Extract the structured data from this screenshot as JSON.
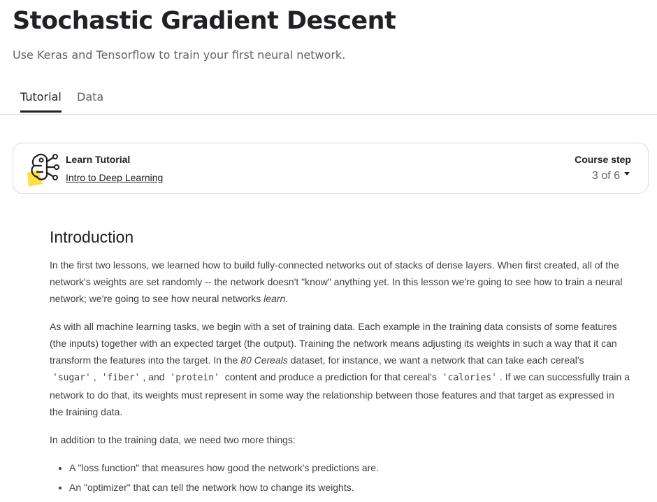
{
  "header": {
    "title": "Stochastic Gradient Descent",
    "subtitle": "Use Keras and Tensorflow to train your first neural network."
  },
  "tabs": [
    {
      "label": "Tutorial",
      "active": true
    },
    {
      "label": "Data",
      "active": false
    }
  ],
  "course_card": {
    "icon": "neural-network-icon",
    "kicker": "Learn Tutorial",
    "course_link": "Intro to Deep Learning",
    "step_label": "Course step",
    "step_value": "3 of 6"
  },
  "article": {
    "heading": "Introduction",
    "p1": {
      "text_a": "In the first two lessons, we learned how to build fully-connected networks out of stacks of dense layers. When first created, all of the network's weights are set randomly -- the network doesn't \"know\" anything yet. In this lesson we're going to see how to train a neural network; we're going to see how neural networks ",
      "emphasis": "learn",
      "text_b": "."
    },
    "p2": {
      "text_a": "As with all machine learning tasks, we begin with a set of training data. Each example in the training data consists of some features (the inputs) together with an expected target (the output). Training the network means adjusting its weights in such a way that it can transform the features into the target. In the ",
      "dataset": "80 Cereals",
      "text_b": " dataset, for instance, we want a network that can take each cereal's ",
      "code_sugar": "'sugar'",
      "sep1": ", ",
      "code_fiber": "'fiber'",
      "sep2": ", and ",
      "code_protein": "'protein'",
      "text_c": " content and produce a prediction for that cereal's ",
      "code_calories": "'calories'",
      "text_d": ". If we can successfully train a network to do that, its weights must represent in some way the relationship between those features and that target as expressed in the training data."
    },
    "p3": "In addition to the training data, we need two more things:",
    "bullets": [
      "A \"loss function\" that measures how good the network's predictions are.",
      "An \"optimizer\" that can tell the network how to change its weights."
    ]
  },
  "colors": {
    "text": "#202124",
    "muted": "#5f6368",
    "border": "#dadce0",
    "icon_accent": "#fde047"
  }
}
